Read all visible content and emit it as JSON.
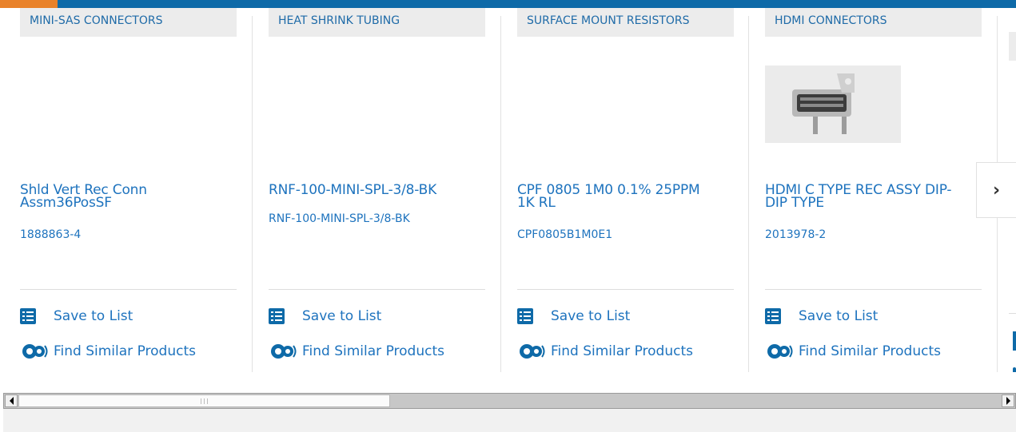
{
  "carousel": {
    "cards": [
      {
        "category": "MINI-SAS CONNECTORS",
        "title": "Shld Vert Rec Conn Assm36PosSF",
        "part_number": "1888863-4",
        "save_label": "Save to List",
        "find_label": "Find Similar Products"
      },
      {
        "category": "HEAT SHRINK TUBING",
        "title": "RNF-100-MINI-SPL-3/8-BK",
        "part_number": "RNF-100-MINI-SPL-3/8-BK",
        "save_label": "Save to List",
        "find_label": "Find Similar Products"
      },
      {
        "category": "SURFACE MOUNT RESISTORS",
        "title": "CPF 0805 1M0 0.1% 25PPM 1K RL",
        "part_number": "CPF0805B1M0E1",
        "save_label": "Save to List",
        "find_label": "Find Similar Products"
      },
      {
        "category": "HDMI CONNECTORS",
        "title": "HDMI C TYPE REC ASSY DIP-DIP TYPE",
        "part_number": "2013978-2",
        "save_label": "Save to List",
        "find_label": "Find Similar Products"
      }
    ],
    "next_arrow": "›"
  },
  "icons": {
    "save": "checklist-icon",
    "find": "gears-icon",
    "next": "chevron-right-icon"
  },
  "colors": {
    "brand_blue": "#0e6aa8",
    "link_blue": "#1e73be",
    "accent_orange": "#e9822a"
  }
}
